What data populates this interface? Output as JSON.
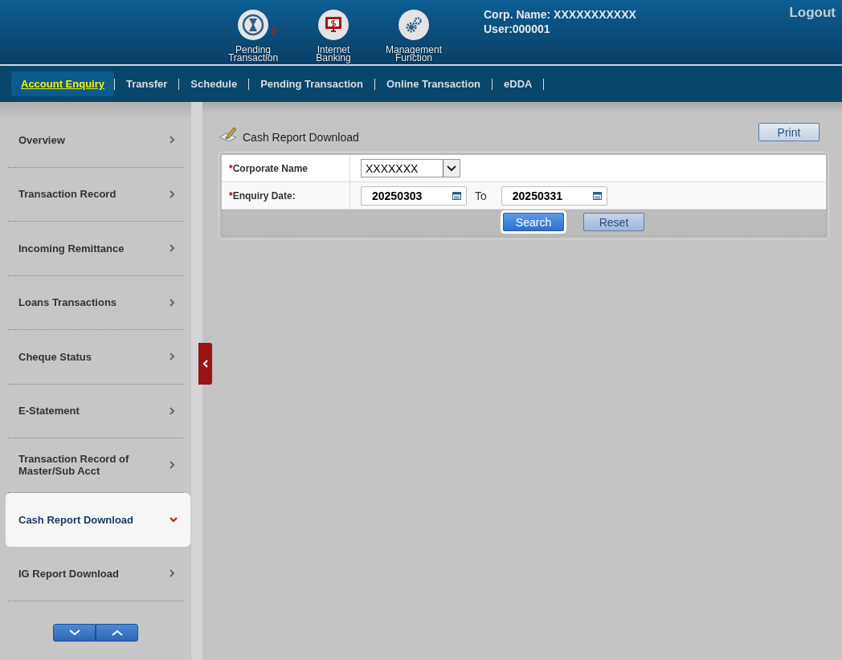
{
  "header": {
    "shortcuts": [
      {
        "kind": "pending",
        "label": "Pending Transaction",
        "badge": "2"
      },
      {
        "kind": "banking",
        "label": "Internet Banking"
      },
      {
        "kind": "management",
        "label": "Management Function"
      }
    ],
    "corp_name": "Corp. Name: XXXXXXXXXXX",
    "user": "User:000001",
    "logout": "Logout"
  },
  "nav": [
    {
      "label": "Account Enquiry",
      "selected": true
    },
    {
      "label": "Transfer",
      "selected": false
    },
    {
      "label": "Schedule",
      "selected": false
    },
    {
      "label": "Pending Transaction",
      "selected": false
    },
    {
      "label": "Online Transaction",
      "selected": false
    },
    {
      "label": "eDDA",
      "selected": false
    }
  ],
  "sidebar": {
    "items": [
      {
        "label": "Overview",
        "selected": false
      },
      {
        "label": "Transaction Record",
        "selected": false
      },
      {
        "label": "Incoming Remittance",
        "selected": false
      },
      {
        "label": "Loans Transactions",
        "selected": false
      },
      {
        "label": "Cheque Status",
        "selected": false
      },
      {
        "label": "E-Statement",
        "selected": false
      },
      {
        "label": "Transaction Record of Master/Sub Acct",
        "selected": false
      },
      {
        "label": "Cash Report Download",
        "selected": true
      },
      {
        "label": "IG Report Download",
        "selected": false
      }
    ]
  },
  "page": {
    "title": "Cash Report Download",
    "print": "Print",
    "form": {
      "corporate_label": "Corporate Name",
      "corporate_value": "XXXXXXX",
      "date_label": "Enquiry Date:",
      "date_from": "20250303",
      "to": "To",
      "date_to": "20250331",
      "required_mark": "*"
    },
    "buttons": [
      {
        "kind": "primary",
        "label": "Search"
      },
      {
        "kind": "secondary",
        "label": "Reset"
      }
    ]
  }
}
